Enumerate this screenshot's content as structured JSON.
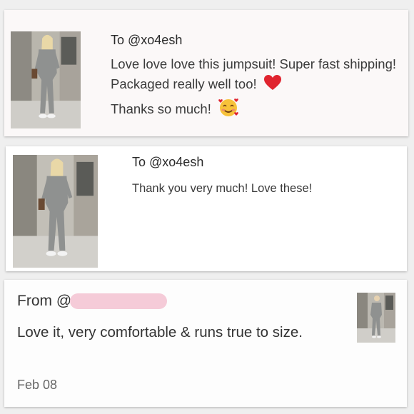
{
  "cards": [
    {
      "title": "To @xo4esh",
      "message": "Love love love this jumpsuit! Super fast shipping! Packaged really well too!",
      "message_tail": "Thanks so much!",
      "emoji_1": "red-heart",
      "emoji_2": "smiling-face-with-hearts"
    },
    {
      "title": "To @xo4esh",
      "message": "Thank you very much! Love these!"
    },
    {
      "from_prefix": "From @",
      "handle_redacted": true,
      "review": "Love it, very comfortable & runs true to size.",
      "date": "Feb 08"
    }
  ],
  "colors": {
    "redaction": "#f5cbd8",
    "heart": "#e0242f",
    "card_bg": "#ffffff",
    "page_bg": "#efefef"
  }
}
